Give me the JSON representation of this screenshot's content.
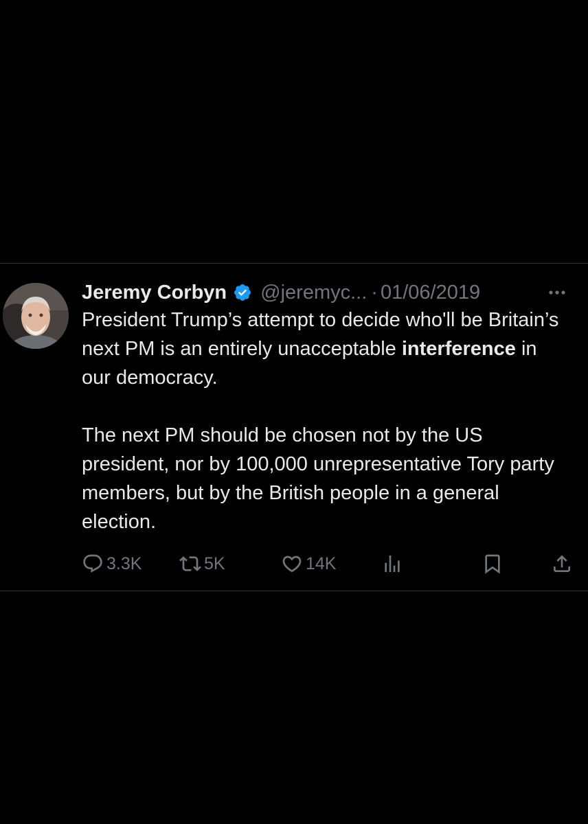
{
  "tweet": {
    "author_name": "Jeremy Corbyn",
    "handle": "@jeremyc...",
    "separator": "·",
    "date": "01/06/2019",
    "paragraph1_before": "President Trump’s attempt to decide who'll be Britain’s next PM is an entirely unacceptable ",
    "paragraph1_bold": "interference",
    "paragraph1_after": " in our democracy.",
    "paragraph2": "The next PM should be chosen not by the US president, nor by 100,000 unrepresentative Tory party members, but by the British people in a general election."
  },
  "actions": {
    "replies": "3.3K",
    "reposts": "5K",
    "likes": "14K"
  },
  "icons": {
    "verified": "verified-badge-icon",
    "more": "more-icon",
    "reply": "reply-icon",
    "repost": "repost-icon",
    "like": "heart-icon",
    "views": "views-icon",
    "bookmark": "bookmark-icon",
    "share": "share-icon"
  },
  "colors": {
    "background": "#000000",
    "text": "#e7e9ea",
    "muted": "#71767b",
    "verified": "#1d9bf0",
    "divider": "#2f3336"
  }
}
